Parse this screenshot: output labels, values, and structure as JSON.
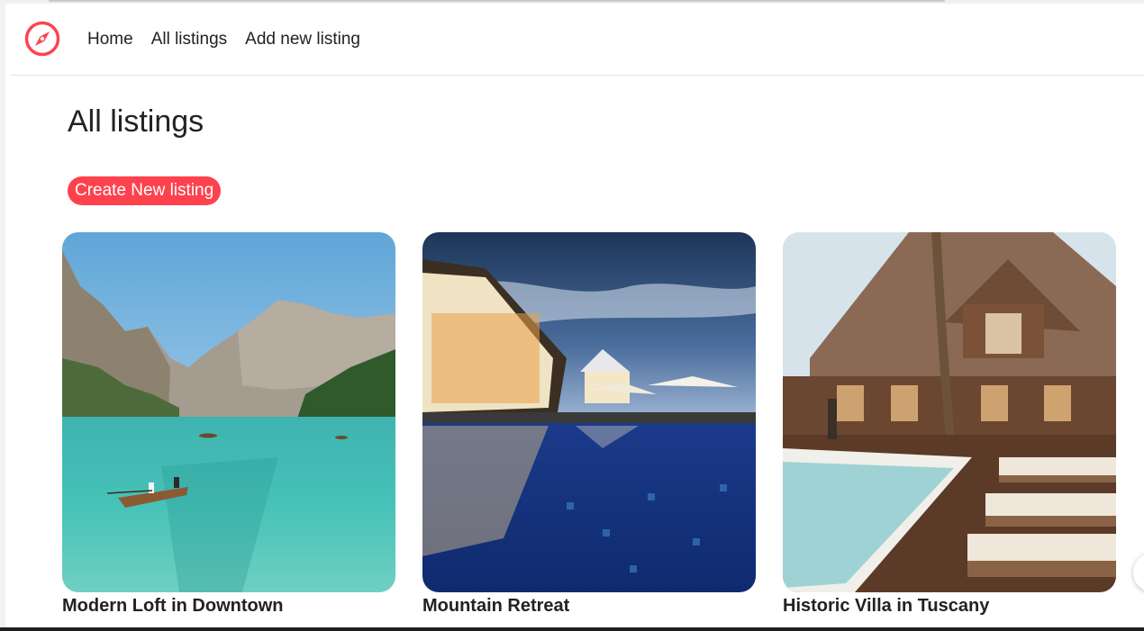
{
  "navbar": {
    "logo_icon": "compass-icon",
    "brand_color": "#fe424d",
    "links": [
      {
        "label": "Home"
      },
      {
        "label": "All listings"
      },
      {
        "label": "Add new listing"
      }
    ]
  },
  "main": {
    "title": "All listings",
    "create_button_label": "Create New listing",
    "accent_color": "#fe424d"
  },
  "listings": [
    {
      "title": "Modern Loft in Downtown",
      "image": "lake-mountains-rowboat-photo"
    },
    {
      "title": "Mountain Retreat",
      "image": "resort-pool-dusk-photo"
    },
    {
      "title": "Historic Villa in Tuscany",
      "image": "wooden-villa-pool-loungers-photo"
    }
  ]
}
